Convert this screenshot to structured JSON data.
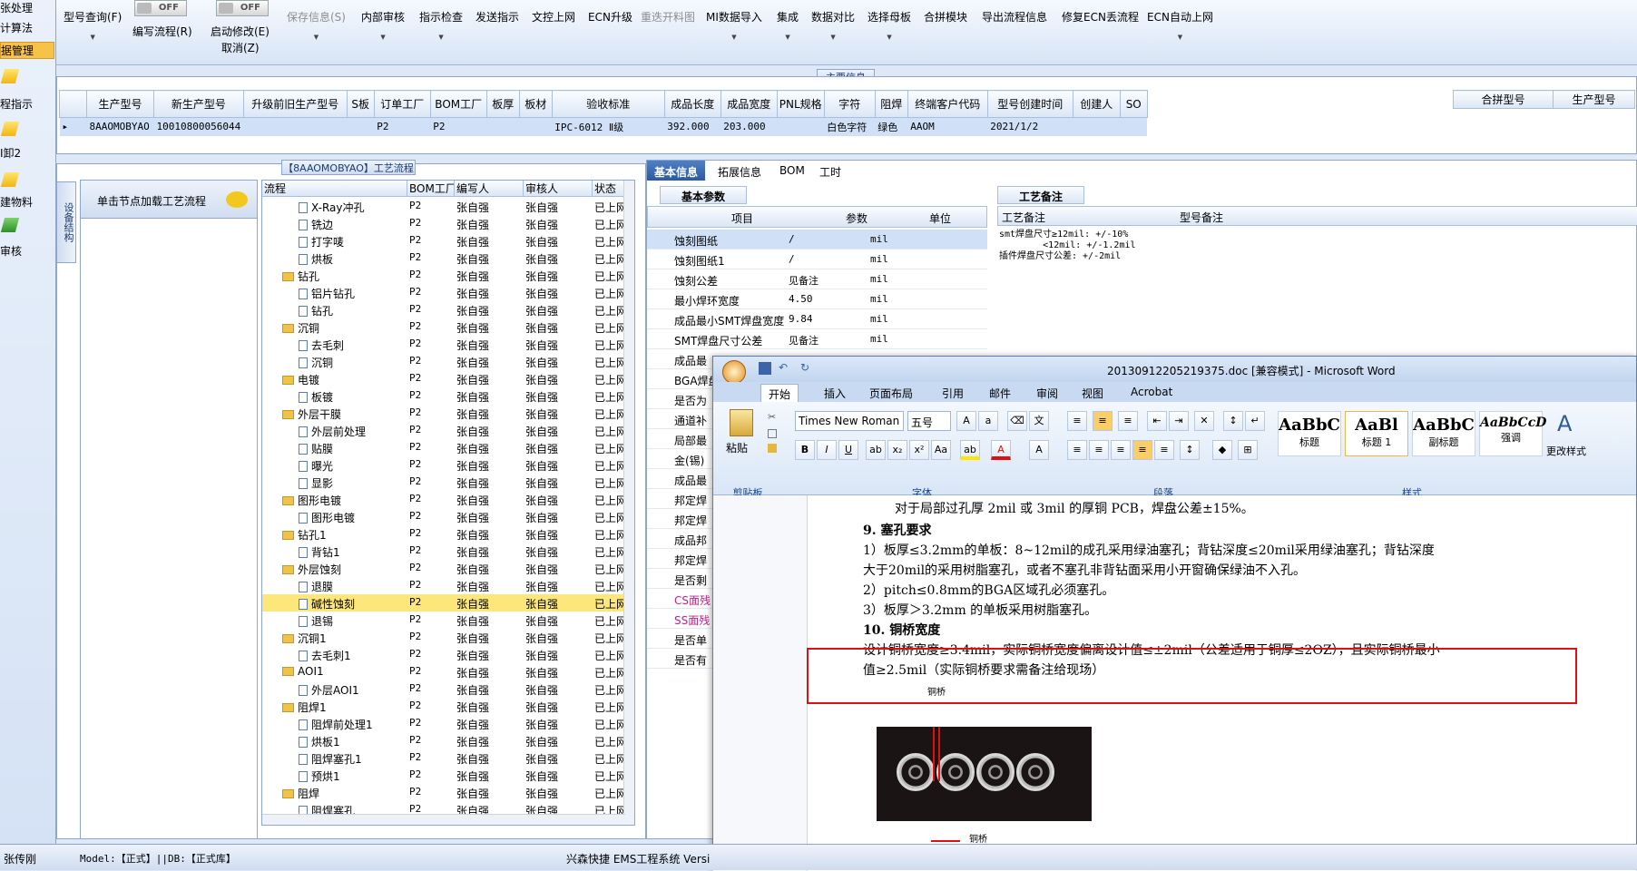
{
  "leftnav": {
    "items": [
      "张处理",
      "计算法",
      "据管理",
      "程指示",
      "I卸2",
      "建物料",
      "审核"
    ]
  },
  "toolbar": {
    "buttons": [
      "型号查询(F)",
      "编写流程(R)",
      "启动修改(E)",
      "取消(Z)",
      "保存信息(S)",
      "内部审核",
      "指示检查",
      "发送指示",
      "文控上网",
      "ECN升级",
      "重迭开料图",
      "MI数据导入",
      "集成",
      "数据对比",
      "选择母板",
      "合拼模块",
      "导出流程信息",
      "修复ECN丢流程",
      "ECN自动上网"
    ],
    "toggle_text": "OFF"
  },
  "main": {
    "title": "主要信息",
    "columns": [
      "生产型号",
      "新生产型号",
      "升级前旧生产型号",
      "S板",
      "订单工厂",
      "BOM工厂",
      "板厚",
      "板材",
      "验收标准",
      "成品长度",
      "成品宽度",
      "PNL规格",
      "字符",
      "阻焊",
      "终端客户代码",
      "型号创建时间",
      "创建人",
      "SO"
    ],
    "row": [
      "8AAOMOBYAO",
      "10010800056044",
      "",
      "",
      "P2",
      "P2",
      "",
      "",
      "IPC-6012 Ⅱ级",
      "392.000",
      "203.000",
      "",
      "白色字符",
      "绿色",
      "AAOM",
      "2021/1/2",
      "",
      ""
    ],
    "merge_columns": [
      "合拼型号",
      "生产型号"
    ]
  },
  "process": {
    "title": "【8AAOMOBYAO】工艺流程",
    "vtab": "设备结构",
    "node_hint": "单击节点加载工艺流程",
    "columns": [
      "流程",
      "BOM工厂",
      "编写人",
      "审核人",
      "状态"
    ],
    "rows": [
      {
        "name": "X-Ray冲孔",
        "level": 2,
        "bom": "P2",
        "writer": "张自强",
        "reviewer": "张自强",
        "status": "已上网"
      },
      {
        "name": "铣边",
        "level": 2,
        "bom": "P2",
        "writer": "张自强",
        "reviewer": "张自强",
        "status": "已上网"
      },
      {
        "name": "打字唛",
        "level": 2,
        "bom": "P2",
        "writer": "张自强",
        "reviewer": "张自强",
        "status": "已上网"
      },
      {
        "name": "烘板",
        "level": 2,
        "bom": "P2",
        "writer": "张自强",
        "reviewer": "张自强",
        "status": "已上网"
      },
      {
        "name": "钻孔",
        "level": 1,
        "bom": "P2",
        "writer": "张自强",
        "reviewer": "张自强",
        "status": "已上网"
      },
      {
        "name": "铝片钻孔",
        "level": 2,
        "bom": "P2",
        "writer": "张自强",
        "reviewer": "张自强",
        "status": "已上网"
      },
      {
        "name": "钻孔",
        "level": 2,
        "bom": "P2",
        "writer": "张自强",
        "reviewer": "张自强",
        "status": "已上网"
      },
      {
        "name": "沉铜",
        "level": 1,
        "bom": "P2",
        "writer": "张自强",
        "reviewer": "张自强",
        "status": "已上网"
      },
      {
        "name": "去毛刺",
        "level": 2,
        "bom": "P2",
        "writer": "张自强",
        "reviewer": "张自强",
        "status": "已上网"
      },
      {
        "name": "沉铜",
        "level": 2,
        "bom": "P2",
        "writer": "张自强",
        "reviewer": "张自强",
        "status": "已上网"
      },
      {
        "name": "电镀",
        "level": 1,
        "bom": "P2",
        "writer": "张自强",
        "reviewer": "张自强",
        "status": "已上网"
      },
      {
        "name": "板镀",
        "level": 2,
        "bom": "P2",
        "writer": "张自强",
        "reviewer": "张自强",
        "status": "已上网"
      },
      {
        "name": "外层干膜",
        "level": 1,
        "bom": "P2",
        "writer": "张自强",
        "reviewer": "张自强",
        "status": "已上网"
      },
      {
        "name": "外层前处理",
        "level": 2,
        "bom": "P2",
        "writer": "张自强",
        "reviewer": "张自强",
        "status": "已上网"
      },
      {
        "name": "贴膜",
        "level": 2,
        "bom": "P2",
        "writer": "张自强",
        "reviewer": "张自强",
        "status": "已上网"
      },
      {
        "name": "曝光",
        "level": 2,
        "bom": "P2",
        "writer": "张自强",
        "reviewer": "张自强",
        "status": "已上网"
      },
      {
        "name": "显影",
        "level": 2,
        "bom": "P2",
        "writer": "张自强",
        "reviewer": "张自强",
        "status": "已上网"
      },
      {
        "name": "图形电镀",
        "level": 1,
        "bom": "P2",
        "writer": "张自强",
        "reviewer": "张自强",
        "status": "已上网"
      },
      {
        "name": "图形电镀",
        "level": 2,
        "bom": "P2",
        "writer": "张自强",
        "reviewer": "张自强",
        "status": "已上网"
      },
      {
        "name": "钻孔1",
        "level": 1,
        "bom": "P2",
        "writer": "张自强",
        "reviewer": "张自强",
        "status": "已上网"
      },
      {
        "name": "背钻1",
        "level": 2,
        "bom": "P2",
        "writer": "张自强",
        "reviewer": "张自强",
        "status": "已上网"
      },
      {
        "name": "外层蚀刻",
        "level": 1,
        "bom": "P2",
        "writer": "张自强",
        "reviewer": "张自强",
        "status": "已上网"
      },
      {
        "name": "退膜",
        "level": 2,
        "bom": "P2",
        "writer": "张自强",
        "reviewer": "张自强",
        "status": "已上网"
      },
      {
        "name": "碱性蚀刻",
        "level": 2,
        "bom": "P2",
        "writer": "张自强",
        "reviewer": "张自强",
        "status": "已上网",
        "selected": true
      },
      {
        "name": "退锡",
        "level": 2,
        "bom": "P2",
        "writer": "张自强",
        "reviewer": "张自强",
        "status": "已上网"
      },
      {
        "name": "沉铜1",
        "level": 1,
        "bom": "P2",
        "writer": "张自强",
        "reviewer": "张自强",
        "status": "已上网"
      },
      {
        "name": "去毛刺1",
        "level": 2,
        "bom": "P2",
        "writer": "张自强",
        "reviewer": "张自强",
        "status": "已上网"
      },
      {
        "name": "AOI1",
        "level": 1,
        "bom": "P2",
        "writer": "张自强",
        "reviewer": "张自强",
        "status": "已上网"
      },
      {
        "name": "外层AOI1",
        "level": 2,
        "bom": "P2",
        "writer": "张自强",
        "reviewer": "张自强",
        "status": "已上网"
      },
      {
        "name": "阻焊1",
        "level": 1,
        "bom": "P2",
        "writer": "张自强",
        "reviewer": "张自强",
        "status": "已上网"
      },
      {
        "name": "阻焊前处理1",
        "level": 2,
        "bom": "P2",
        "writer": "张自强",
        "reviewer": "张自强",
        "status": "已上网"
      },
      {
        "name": "烘板1",
        "level": 2,
        "bom": "P2",
        "writer": "张自强",
        "reviewer": "张自强",
        "status": "已上网"
      },
      {
        "name": "阻焊塞孔1",
        "level": 2,
        "bom": "P2",
        "writer": "张自强",
        "reviewer": "张自强",
        "status": "已上网"
      },
      {
        "name": "预烘1",
        "level": 2,
        "bom": "P2",
        "writer": "张自强",
        "reviewer": "张自强",
        "status": "已上网"
      },
      {
        "name": "阻焊",
        "level": 1,
        "bom": "P2",
        "writer": "张自强",
        "reviewer": "张自强",
        "status": "已上网"
      },
      {
        "name": "阻焊塞孔",
        "level": 2,
        "bom": "P2",
        "writer": "张自强",
        "reviewer": "张自强",
        "status": "已上网"
      }
    ]
  },
  "right": {
    "tabs": [
      "基本信息",
      "拓展信息",
      "BOM",
      "工时"
    ],
    "basic_title": "基本参数",
    "notes_title": "工艺备注",
    "param_columns": [
      "项目",
      "参数",
      "单位"
    ],
    "params": [
      {
        "item": "蚀刻图纸",
        "value": "/",
        "unit": "mil"
      },
      {
        "item": "蚀刻图纸1",
        "value": "/",
        "unit": "mil"
      },
      {
        "item": "蚀刻公差",
        "value": "见备注",
        "unit": "mil"
      },
      {
        "item": "最小焊环宽度",
        "value": "4.50",
        "unit": "mil"
      },
      {
        "item": "成品最小SMT焊盘宽度",
        "value": "9.84",
        "unit": "mil"
      },
      {
        "item": "SMT焊盘尺寸公差",
        "value": "见备注",
        "unit": "mil"
      },
      {
        "item": "成品最",
        "value": "",
        "unit": ""
      },
      {
        "item": "BGA焊盘",
        "value": "",
        "unit": ""
      },
      {
        "item": "是否为",
        "value": "",
        "unit": ""
      },
      {
        "item": "通道补",
        "value": "",
        "unit": ""
      },
      {
        "item": "局部最",
        "value": "",
        "unit": ""
      },
      {
        "item": "金(锡)",
        "value": "",
        "unit": ""
      },
      {
        "item": "成品最",
        "value": "",
        "unit": ""
      },
      {
        "item": "邦定焊",
        "value": "",
        "unit": ""
      },
      {
        "item": "邦定焊",
        "value": "",
        "unit": ""
      },
      {
        "item": "成品邦",
        "value": "",
        "unit": ""
      },
      {
        "item": "邦定焊",
        "value": "",
        "unit": ""
      },
      {
        "item": "是否剩",
        "value": "",
        "unit": ""
      },
      {
        "item": "CS面残",
        "value": "",
        "unit": ""
      },
      {
        "item": "SS面残",
        "value": "",
        "unit": ""
      },
      {
        "item": "是否单",
        "value": "",
        "unit": ""
      },
      {
        "item": "是否有",
        "value": "",
        "unit": ""
      }
    ],
    "notes_columns": [
      "工艺备注",
      "型号备注"
    ],
    "notes_lines": [
      "smt焊盘尺寸≥12mil: +/-10%",
      "        <12mil: +/-1.2mil",
      "插件焊盘尺寸公差: +/-2mil"
    ]
  },
  "word": {
    "title": "20130912205219375.doc [兼容模式] - Microsoft Word",
    "tabs": [
      "开始",
      "插入",
      "页面布局",
      "引用",
      "邮件",
      "审阅",
      "视图",
      "Acrobat"
    ],
    "font": "Times New Roman",
    "size": "五号",
    "clipboard": "剪贴板",
    "font_group": "字体",
    "para_group": "段落",
    "style_group": "样式",
    "paste": "粘贴",
    "change_style": "更改样式",
    "styles": [
      {
        "sample": "AaBbC",
        "name": "标题"
      },
      {
        "sample": "AaBl",
        "name": "标题 1"
      },
      {
        "sample": "AaBbC",
        "name": "副标题"
      },
      {
        "sample": "AaBbCcD",
        "name": "强调"
      }
    ],
    "lines": [
      "对于局部过孔厚 2mil 或 3mil 的厚铜 PCB，焊盘公差±15%。",
      "9. 塞孔要求",
      "1）板厚≤3.2mm的单板：8~12mil的成孔采用绿油塞孔；背钻深度≤20mil采用绿油塞孔；背钻深度",
      "大于20mil的采用树脂塞孔，或者不塞孔非背钻面采用小开窗确保绿油不入孔。",
      "2）pitch≤0.8mm的BGA区域孔必须塞孔。",
      "3）板厚＞3.2mm 的单板采用树脂塞孔。",
      "10. 铜桥宽度",
      "设计铜桥宽度≥3.4mil，实际铜桥宽度偏离设计值≤±2mil（公差适用于铜厚≤2OZ），且实际铜桥最小",
      "值≥2.5mil（实际铜桥要求需备注给现场）"
    ],
    "figure_labels": [
      "铜桥",
      "铜桥"
    ]
  },
  "status": {
    "user": "张传刚",
    "model": "Model:【正式】||DB:【正式库】",
    "company": "兴森快捷 EMS工程系统 Versi"
  }
}
